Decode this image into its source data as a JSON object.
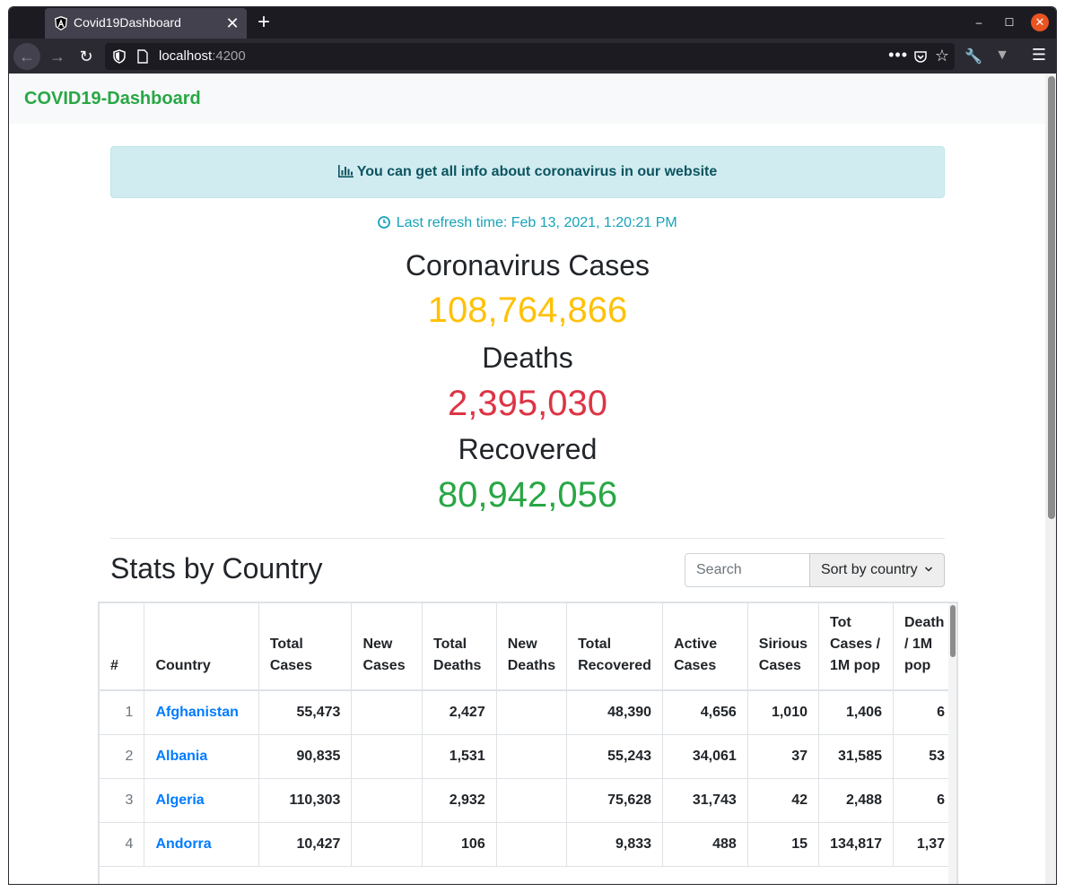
{
  "browser": {
    "tab_title": "Covid19Dashboard",
    "url_host": "localhost",
    "url_port": ":4200"
  },
  "app": {
    "brand": "COVID19-Dashboard",
    "alert_text": "You can get all info about coronavirus in our website",
    "refresh_text": "Last refresh time: Feb 13, 2021, 1:20:21 PM",
    "cases_label": "Coronavirus Cases",
    "cases_value": "108,764,866",
    "deaths_label": "Deaths",
    "deaths_value": "2,395,030",
    "recovered_label": "Recovered",
    "recovered_value": "80,942,056",
    "section_title": "Stats by Country",
    "search_placeholder": "Search",
    "sort_label": "Sort by country"
  },
  "colors": {
    "cases": "#ffc107",
    "deaths": "#dc3545",
    "recovered": "#28a745",
    "link": "#007bff"
  },
  "table": {
    "columns": [
      "#",
      "Country",
      "Total Cases",
      "New Cases",
      "Total Deaths",
      "New Deaths",
      "Total Recovered",
      "Active Cases",
      "Sirious Cases",
      "Tot Cases / 1M pop",
      "Death / 1M pop"
    ],
    "rows": [
      [
        "1",
        "Afghanistan",
        "55,473",
        "",
        "2,427",
        "",
        "48,390",
        "4,656",
        "1,010",
        "1,406",
        "6"
      ],
      [
        "2",
        "Albania",
        "90,835",
        "",
        "1,531",
        "",
        "55,243",
        "34,061",
        "37",
        "31,585",
        "53"
      ],
      [
        "3",
        "Algeria",
        "110,303",
        "",
        "2,932",
        "",
        "75,628",
        "31,743",
        "42",
        "2,488",
        "6"
      ],
      [
        "4",
        "Andorra",
        "10,427",
        "",
        "106",
        "",
        "9,833",
        "488",
        "15",
        "134,817",
        "1,37"
      ]
    ]
  }
}
